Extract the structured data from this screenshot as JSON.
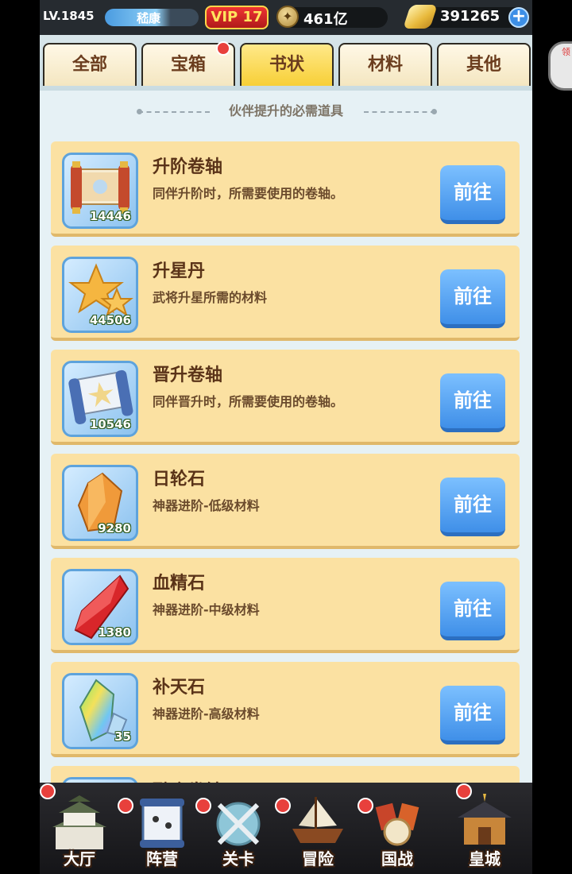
{
  "topbar": {
    "level": "LV.1845",
    "player_name": "嵇康",
    "vip": "VIP 17",
    "copper": "461亿",
    "gold": "391265"
  },
  "tabs": [
    {
      "label": "全部",
      "active": false,
      "dot": false
    },
    {
      "label": "宝箱",
      "active": false,
      "dot": true
    },
    {
      "label": "书状",
      "active": true,
      "dot": false
    },
    {
      "label": "材料",
      "active": false,
      "dot": false
    },
    {
      "label": "其他",
      "active": false,
      "dot": false
    }
  ],
  "subtitle": "伙伴提升的必需道具",
  "items": [
    {
      "name": "升阶卷轴",
      "desc": "同伴升阶时，所需要使用的卷轴。",
      "count": "14446",
      "icon": "scroll-red-icon",
      "button": "前往"
    },
    {
      "name": "升星丹",
      "desc": "武将升星所需的材料",
      "count": "44506",
      "icon": "star-pill-icon",
      "button": "前往"
    },
    {
      "name": "晋升卷轴",
      "desc": "同伴晋升时，所需要使用的卷轴。",
      "count": "10546",
      "icon": "scroll-blue-icon",
      "button": "前往"
    },
    {
      "name": "日轮石",
      "desc": "神器进阶-低级材料",
      "count": "9280",
      "icon": "orange-crystal-icon",
      "button": "前往"
    },
    {
      "name": "血精石",
      "desc": "神器进阶-中级材料",
      "count": "1380",
      "icon": "red-crystal-icon",
      "button": "前往"
    },
    {
      "name": "补天石",
      "desc": "神器进阶-高级材料",
      "count": "35",
      "icon": "rainbow-crystal-icon",
      "button": "前往"
    },
    {
      "name": "融合卷轴",
      "desc": "",
      "count": "",
      "icon": "scroll-icon",
      "button": ""
    }
  ],
  "nav": [
    {
      "label": "大厅",
      "icon": "castle-icon"
    },
    {
      "label": "阵营",
      "icon": "scroll-map-icon"
    },
    {
      "label": "关卡",
      "icon": "crossed-swords-icon"
    },
    {
      "label": "冒险",
      "icon": "ship-icon"
    },
    {
      "label": "国战",
      "icon": "war-flags-icon"
    },
    {
      "label": "皇城",
      "icon": "palace-icon"
    }
  ],
  "float_label": "领"
}
